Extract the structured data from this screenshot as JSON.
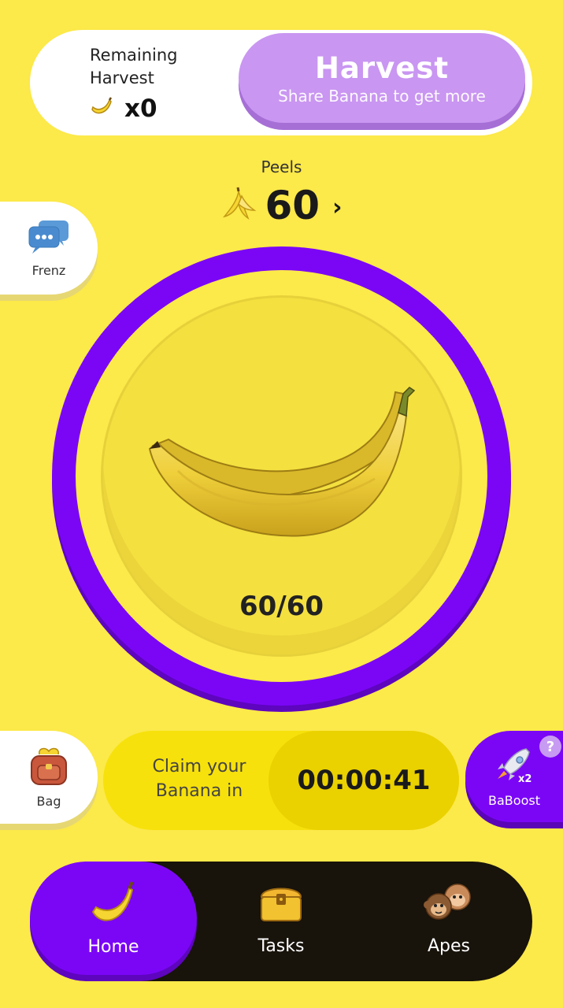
{
  "harvest_card": {
    "remaining_label": "Remaining Harvest",
    "remaining_count": "x0",
    "button_title": "Harvest",
    "button_subtitle": "Share Banana to get more"
  },
  "peels": {
    "label": "Peels",
    "value": "60",
    "chevron": "›"
  },
  "frenz": {
    "label": "Frenz",
    "icon": "chat-bubbles-icon"
  },
  "main_banana": {
    "energy_text": "60/60",
    "icon": "banana-icon"
  },
  "bag": {
    "label": "Bag",
    "icon": "backpack-icon"
  },
  "claim": {
    "label": "Claim your Banana in",
    "timer": "00:00:41"
  },
  "baboost": {
    "label": "BaBoost",
    "help": "?",
    "multiplier": "x2",
    "icon": "rocket-icon"
  },
  "nav": {
    "home": "Home",
    "tasks": "Tasks",
    "apes": "Apes"
  },
  "colors": {
    "background": "#FCE94A",
    "purple": "#7B06F6",
    "harvest_button": "#C996F1",
    "nav_dark": "#18130B"
  }
}
